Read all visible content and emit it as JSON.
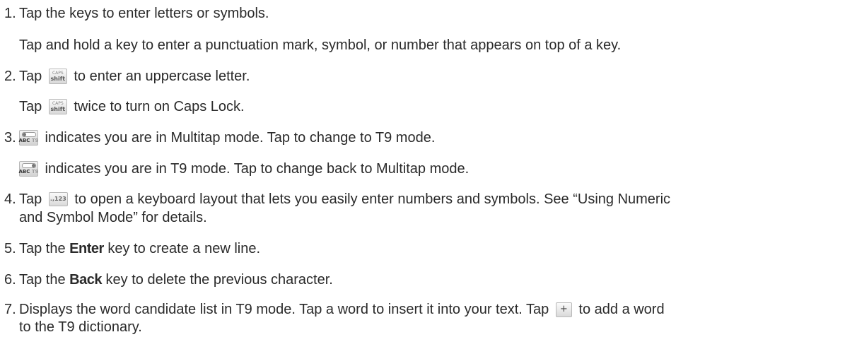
{
  "steps": [
    {
      "number": "1.",
      "lines": [
        "Tap the keys to enter letters or symbols.",
        "Tap and hold a key to enter a punctuation mark, symbol, or number that appears on top of a key."
      ]
    },
    {
      "number": "2.",
      "line1_before": "Tap ",
      "line1_after": " to enter an uppercase letter.",
      "line2_before": "Tap ",
      "line2_after": " twice to turn on Caps Lock."
    },
    {
      "number": "3.",
      "line1_after": " indicates you are in Multitap mode. Tap to change to T9 mode.",
      "line2_after": " indicates you are in T9 mode. Tap to change back to Multitap mode."
    },
    {
      "number": "4.",
      "line1_before": "Tap ",
      "line1_after": " to open a keyboard layout that lets you easily enter numbers and symbols. See “Using Numeric",
      "line2": "and Symbol Mode” for details."
    },
    {
      "number": "5.",
      "before": "Tap the ",
      "bold": "Enter",
      "after": " key to create a new line."
    },
    {
      "number": "6.",
      "before": "Tap the ",
      "bold": "Back",
      "after": " key to delete the previous character."
    },
    {
      "number": "7.",
      "line1_before": "Displays the word candidate list in T9 mode. Tap a word to insert it into your text. Tap ",
      "line1_after": " to add a word",
      "line2": "to the T9 dictionary."
    }
  ],
  "icons": {
    "shift_key": {
      "top_text": "CAPS",
      "bottom_text": "shift"
    },
    "mode_key_multitap": {
      "text": "ABC",
      "dim_text": "T9"
    },
    "mode_key_t9": {
      "text": "ABC",
      "dim_text": "T9"
    },
    "numeric_key": {
      "text": ".,123"
    },
    "add_word_key": {
      "text": "+"
    }
  }
}
